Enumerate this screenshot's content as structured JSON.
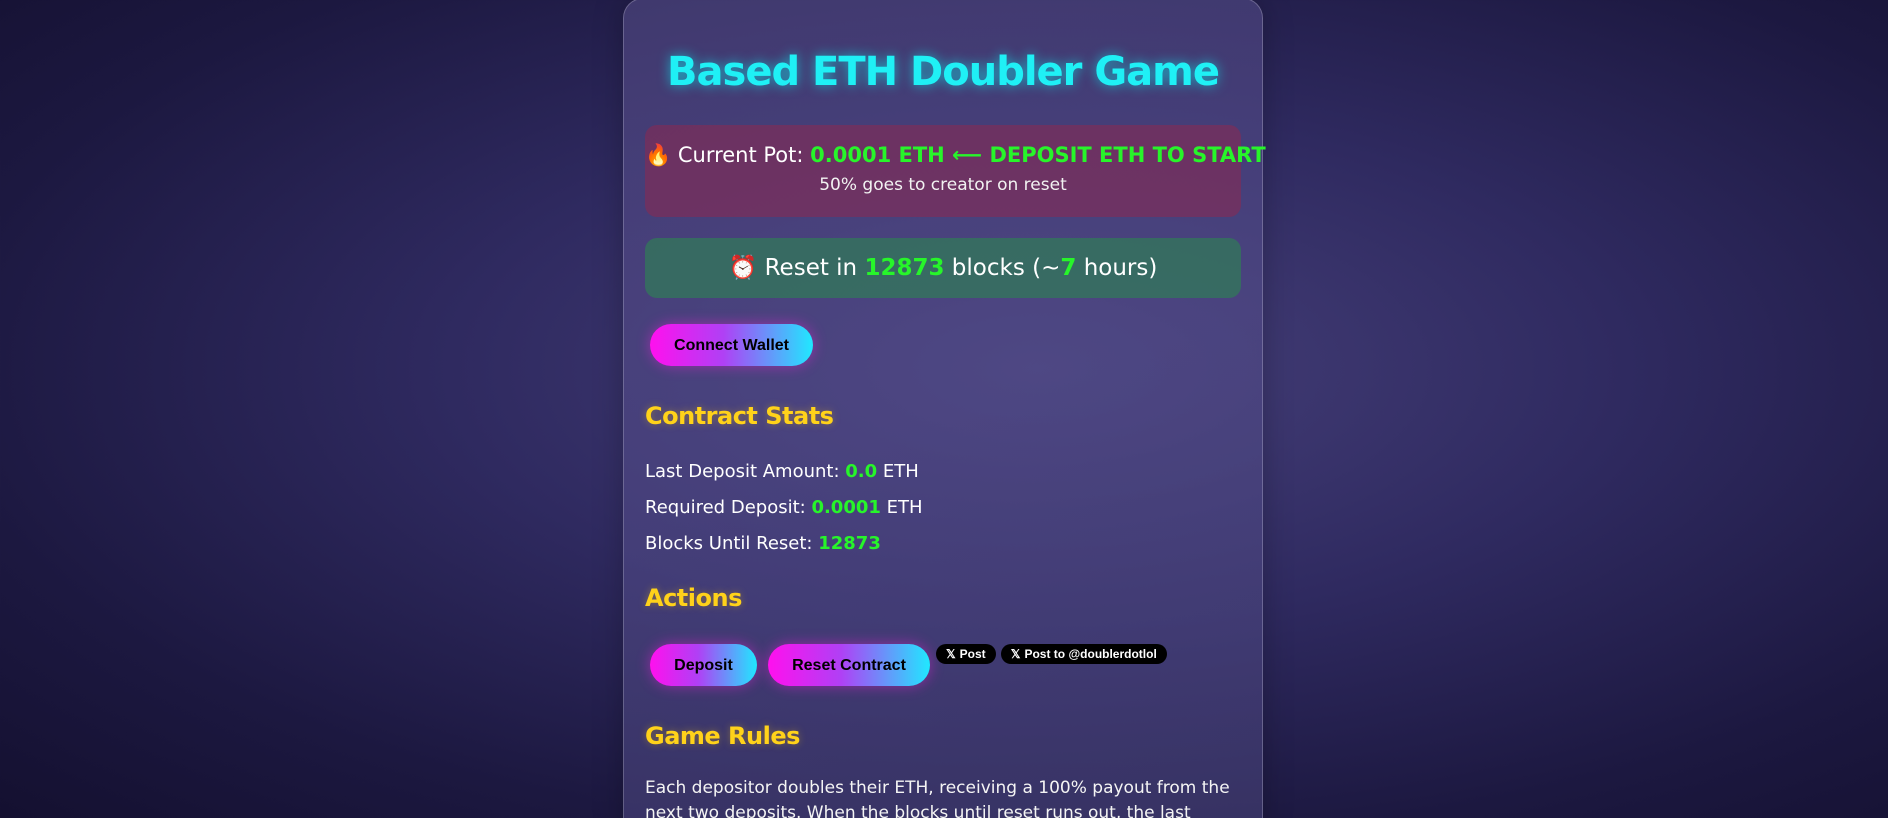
{
  "title": "Based ETH Doubler Game",
  "pot": {
    "icon": "🔥",
    "label": "Current Pot: ",
    "value": "0.0001 ETH ⟵ DEPOSIT ETH TO START",
    "subtext": "50% goes to creator on reset"
  },
  "reset_timer": {
    "icon": "⏰",
    "prefix": "Reset in ",
    "blocks": "12873",
    "middle": " blocks (~",
    "hours": "7",
    "suffix": " hours)"
  },
  "connect_button": "Connect Wallet",
  "stats": {
    "title": "Contract Stats",
    "last_deposit_label": "Last Deposit Amount: ",
    "last_deposit_value": "0.0",
    "last_deposit_unit": " ETH",
    "required_deposit_label": "Required Deposit: ",
    "required_deposit_value": "0.0001",
    "required_deposit_unit": " ETH",
    "blocks_label": "Blocks Until Reset: ",
    "blocks_value": "12873"
  },
  "actions": {
    "title": "Actions",
    "deposit_label": "Deposit",
    "reset_label": "Reset Contract",
    "x_logo": "𝕏",
    "x_post_label": "Post",
    "x_post_to_label": "Post to @doublerdotlol"
  },
  "rules": {
    "title": "Game Rules",
    "text": "Each depositor doubles their ETH, receiving a 100% payout from the next two deposits. When the blocks until reset runs out, the last depositor loses"
  },
  "colors": {
    "title": "#1ff0f5",
    "highlight": "#27f52a",
    "section_title": "#ffd21a"
  }
}
